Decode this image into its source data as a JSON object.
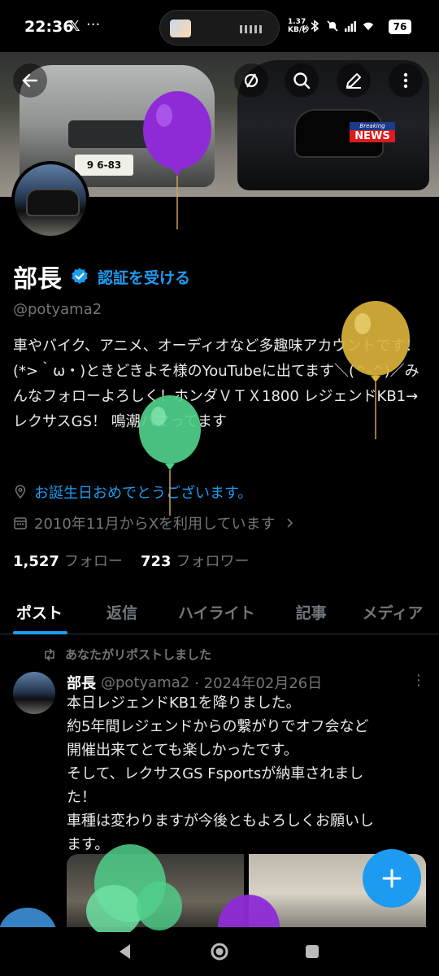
{
  "status_bar": {
    "time": "22:36",
    "x_app": "𝕏",
    "more": "···",
    "speed_top": "1.37",
    "speed_bottom": "KB/秒",
    "battery": "76"
  },
  "banner": {
    "plate": "9 6-83",
    "news_top": "Breaking",
    "news_main": "NEWS"
  },
  "profile": {
    "display_name": "部長",
    "verify_link": "認証を受ける",
    "handle": "@potyama2",
    "bio": "車やバイク、アニメ、オーディオなど多趣味アカウントです！(*>｀ω・)ときどきよそ様のYouTubeに出てます＼(^-^)／みんなフォローよろしく！ホンダＶＴＸ1800 レジェンドKB1→レクサスGS！ 鳴潮ハマってます",
    "birthday": "お誕生日おめでとうございます。",
    "joined": "2010年11月からXを利用しています",
    "following_count": "1,527",
    "following_label": "フォロー",
    "followers_count": "723",
    "followers_label": "フォロワー"
  },
  "tabs": [
    "ポスト",
    "返信",
    "ハイライト",
    "記事",
    "メディア"
  ],
  "post": {
    "repost_label": "あなたがリポストしました",
    "author": "部長",
    "handle": "@potyama2",
    "date": "· 2024年02月26日",
    "more": "⋮",
    "body_lines": [
      "本日レジェンドKB1を降りました。",
      "約5年間レジェンドからの繋がりでオフ会など",
      "開催出来てとても楽しかったです。",
      "そして、レクサスGS Fsportsが納車されまし",
      "た！",
      "車種は変わりますが今後ともよろしくお願いし",
      "ます。"
    ]
  },
  "colors": {
    "accent": "#1d9bf0",
    "balloon_purple": "#8e2bd6",
    "balloon_yellow": "#d8b23a",
    "balloon_green": "#4fd08a"
  },
  "icons": {
    "back": "arrow-left-icon",
    "hide": "eye-slash-icon",
    "search": "search-icon",
    "edit": "pencil-icon",
    "more": "more-vertical-icon",
    "compose": "plus-icon"
  }
}
